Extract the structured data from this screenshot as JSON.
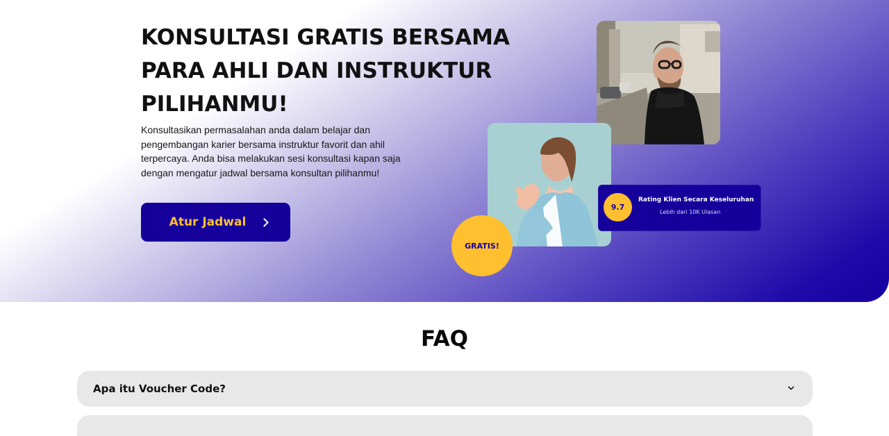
{
  "hero": {
    "title": "KONSULTASI GRATIS BERSAMA PARA AHLI DAN INSTRUKTUR PILIHANMU!",
    "description": "Konsultasikan permasalahan anda dalam belajar  dan pengembangan karier bersama instruktur favorit dan ahil terpercaya. Anda bisa melakukan sesi konsultasi kapan saja dengan mengatur jadwal bersama konsultan pilihanmu!",
    "cta_label": "Atur Jadwal",
    "cta_icon": "chevron-right-icon"
  },
  "rating": {
    "score": "9.7",
    "title": "Rating Klien Secara Keseluruhan",
    "subtitle": "Lebih dari 10K Ulasan"
  },
  "badge": {
    "label": "GRATIS!"
  },
  "faq": {
    "title": "FAQ",
    "items": [
      {
        "question": "Apa itu Voucher Code?",
        "icon": "chevron-down-icon"
      },
      {
        "question": "",
        "icon": ""
      }
    ]
  },
  "colors": {
    "primary": "#15009c",
    "accent": "#ffbf2f",
    "surface": "#e8e8e8"
  }
}
